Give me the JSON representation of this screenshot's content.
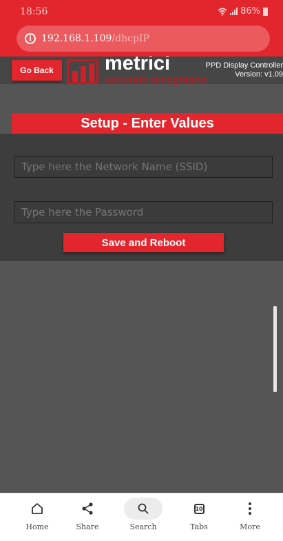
{
  "status_bar": {
    "time": "18:56",
    "battery_text": "86%",
    "icons": [
      "wifi-icon",
      "signal-icon",
      "battery-icon"
    ]
  },
  "address_bar": {
    "host": "192.168.1.109",
    "path": "/dhcpIP",
    "icon": "info-icon"
  },
  "header": {
    "back_label": "Go Back",
    "logo_word": "metrici",
    "logo_tagline": "accurate recognition",
    "controller_name": "PPD Display Controller",
    "version": "Version: v1.09"
  },
  "setup": {
    "title": "Setup - Enter Values",
    "ssid_placeholder": "Type here the Network Name (SSID)",
    "password_placeholder": "Type here the Password",
    "save_label": "Save and Reboot"
  },
  "bottom_nav": {
    "items": [
      {
        "label": "Home",
        "icon": "home-icon"
      },
      {
        "label": "Share",
        "icon": "share-icon"
      },
      {
        "label": "Search",
        "icon": "search-icon"
      },
      {
        "label": "Tabs",
        "icon": "tabs-icon",
        "count": "10"
      },
      {
        "label": "More",
        "icon": "more-icon"
      }
    ]
  },
  "colors": {
    "brand_red": "#e3262e",
    "page_bg": "#555555",
    "form_bg": "#3d3d3d"
  }
}
